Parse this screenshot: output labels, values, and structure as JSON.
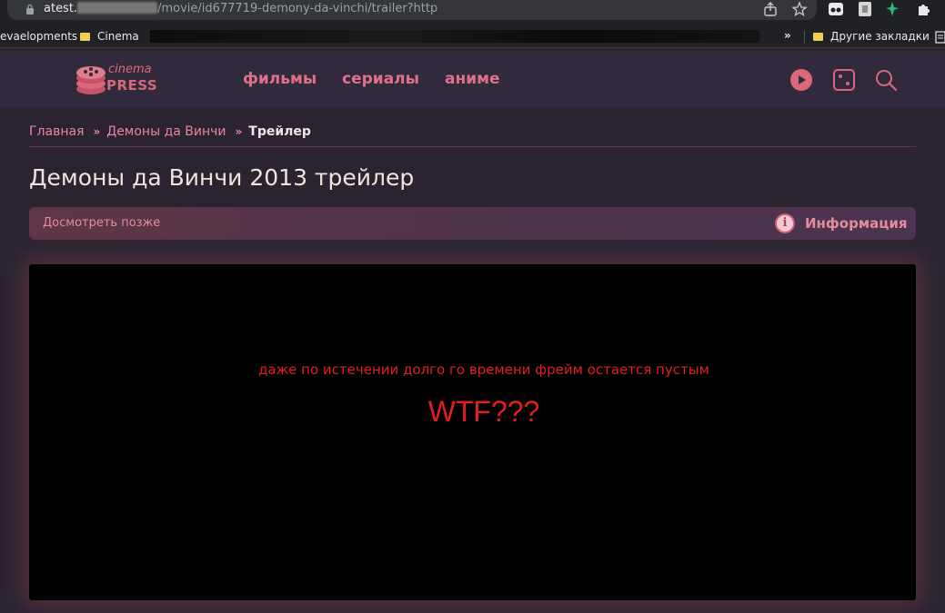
{
  "browser": {
    "url_host": "atest.",
    "url_path": "/movie/id677719-demony-da-vinchi/trailer?http",
    "bookmarks": [
      {
        "label": "evaelopments"
      },
      {
        "label": "Cinema"
      }
    ],
    "more_label": "»",
    "other_bookmarks_label": "Другие закладки"
  },
  "site": {
    "logo_line1": "cinema",
    "logo_line2": "PRESS",
    "nav": [
      {
        "label": "фильмы"
      },
      {
        "label": "сериалы"
      },
      {
        "label": "аниме"
      }
    ],
    "accent_color": "#e0708a"
  },
  "breadcrumb": {
    "items": [
      {
        "label": "Главная"
      },
      {
        "label": "Демоны да Винчи"
      },
      {
        "label": "Трейлер"
      }
    ],
    "separator": "»"
  },
  "page_title": "Демоны да Винчи 2013 трейлер",
  "action_bar": {
    "watch_later": "Досмотреть позже",
    "info_icon": "i",
    "info_label": "Информация"
  },
  "player": {
    "note_line1": "даже по истечении долго го времени фрейм остается пустым",
    "note_line2": "WTF???",
    "note_color": "#e21d1d"
  }
}
